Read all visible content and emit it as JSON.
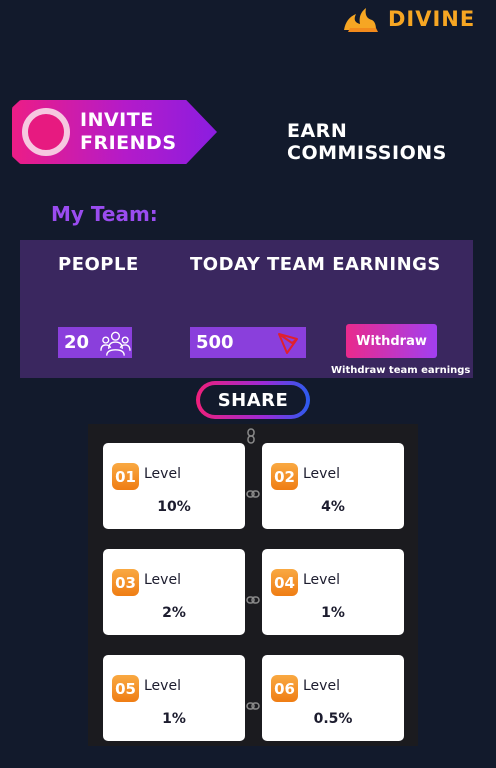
{
  "brand": {
    "name": "DIVINE"
  },
  "invite": {
    "label": "INVITE FRIENDS"
  },
  "earn": {
    "title": "EARN COMMISSIONS"
  },
  "team": {
    "heading": "My Team:",
    "people_label": "PEOPLE",
    "earnings_label": "TODAY TEAM EARNINGS",
    "people_count": "20",
    "earnings_value": "500",
    "withdraw_label": "Withdraw",
    "withdraw_note": "Withdraw team earnings"
  },
  "share": {
    "label": "SHARE"
  },
  "levels": [
    {
      "num": "01",
      "label": "Level",
      "pct": "10%"
    },
    {
      "num": "02",
      "label": "Level",
      "pct": "4%"
    },
    {
      "num": "03",
      "label": "Level",
      "pct": "2%"
    },
    {
      "num": "04",
      "label": "Level",
      "pct": "1%"
    },
    {
      "num": "05",
      "label": "Level",
      "pct": "1%"
    },
    {
      "num": "06",
      "label": "Level",
      "pct": "0.5%"
    }
  ],
  "colors": {
    "background": "#121a2c",
    "accent": "#8a3fdc",
    "brand": "#f6a623",
    "level_badge": "#f39a2e"
  },
  "icons": [
    "flame-logo-icon",
    "people-group-icon",
    "tron-icon",
    "chain-link-icon"
  ]
}
